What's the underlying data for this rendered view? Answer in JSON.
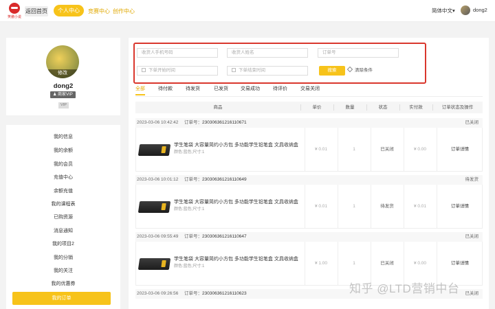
{
  "header": {
    "logo_text": "笑傲小说",
    "nav": [
      "返回首页",
      "个人中心",
      "竞赛中心",
      "创作中心"
    ],
    "language": "简体中文▾",
    "username": "dong2"
  },
  "profile": {
    "avatar_label": "修改",
    "name": "dong2",
    "vip_badge": "♟ 商家VIP",
    "vip_tag": "VIP"
  },
  "sidebar": {
    "items": [
      "我的信息",
      "我的余额",
      "我的会员",
      "充值中心",
      "余额充值",
      "我的课程表",
      "已购资源",
      "消息通知",
      "我的项目2",
      "我的分销",
      "我的关注",
      "我的优惠券",
      "我的订单"
    ],
    "active_index": 12
  },
  "filters": {
    "phone_placeholder": "收货人手机号码",
    "name_placeholder": "收货人姓名",
    "order_placeholder": "订单号",
    "start_placeholder": "下单开始时间",
    "end_placeholder": "下单结束时间",
    "search_label": "搜索",
    "clear_label": "清除条件"
  },
  "tabs": [
    "全部",
    "待付款",
    "待发货",
    "已发货",
    "交易成功",
    "待评价",
    "交易关闭"
  ],
  "table_headers": [
    "商品",
    "单价",
    "数量",
    "状态",
    "实付款",
    "订单状态及操作"
  ],
  "order_no_label": "订单号：",
  "orders": [
    {
      "time": "2023-03-06 10:42:42",
      "order_no": "230306361216110671",
      "status_right": "已关闭",
      "product": "学生笔袋 大容量简约小方包 多功能学生铅笔盒 文具收纳盒",
      "spec": "颜色:蓝色;尺寸:1",
      "price": "¥ 0.01",
      "qty": "1",
      "state": "已关闭",
      "paid": "¥ 0.00",
      "action": "订单详情"
    },
    {
      "time": "2023-03-06 10:01:12",
      "order_no": "230306361216110649",
      "status_right": "待发货",
      "product": "学生笔袋 大容量简约小方包 多功能学生铅笔盒 文具收纳盒",
      "spec": "颜色:蓝色;尺寸:1",
      "price": "¥ 0.01",
      "qty": "1",
      "state": "待发货",
      "paid": "¥ 0.01",
      "action": "订单详情"
    },
    {
      "time": "2023-03-06 09:55:49",
      "order_no": "230306361216110647",
      "status_right": "已关闭",
      "product": "学生笔袋 大容量简约小方包 多功能学生铅笔盒 文具收纳盒",
      "spec": "颜色:蓝色;尺寸:1",
      "price": "¥ 1.00",
      "qty": "1",
      "state": "已关闭",
      "paid": "¥ 0.00",
      "action": "订单详情"
    },
    {
      "time": "2023-03-06 09:26:56",
      "order_no": "230306361216110623",
      "status_right": "已关闭"
    }
  ],
  "watermark": "知乎 @LTD营销中台"
}
